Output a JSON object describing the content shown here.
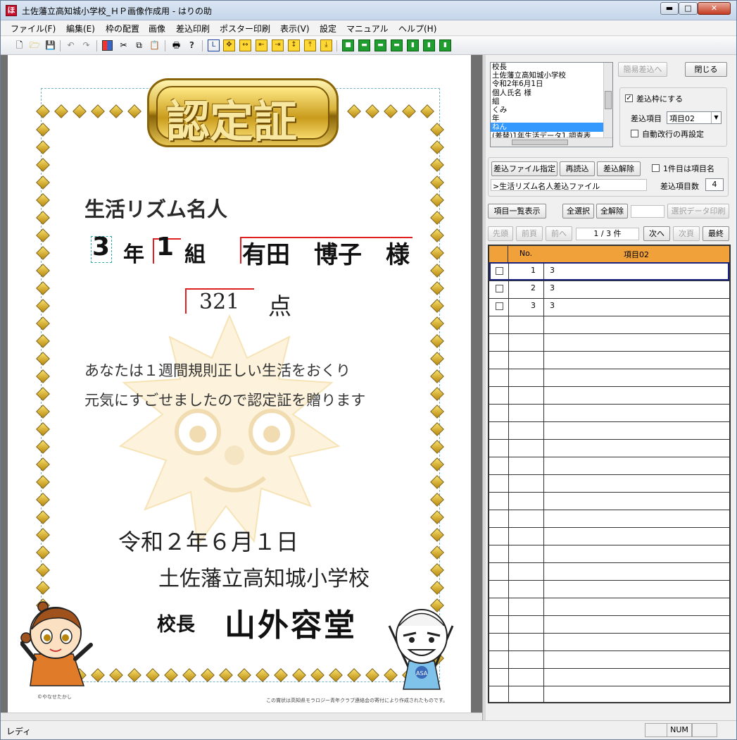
{
  "window": {
    "title": "土佐藩立高知城小学校_ＨＰ画像作成用 - はりの助",
    "icon_label": "ほ",
    "minimize": "▬",
    "maximize": "□",
    "close": "✕"
  },
  "menu": [
    "ファイル(F)",
    "編集(E)",
    "枠の配置",
    "画像",
    "差込印刷",
    "ポスター印刷",
    "表示(V)",
    "設定",
    "マニュアル",
    "ヘルプ(H)"
  ],
  "toolbar_icons": [
    "new-icon",
    "open-icon",
    "save-icon",
    "undo-icon",
    "redo-icon",
    "frame-icon",
    "cut-icon",
    "copy-icon",
    "paste-icon",
    "print-icon",
    "help-icon",
    "align-corner-icon",
    "move-all-icon",
    "stretch-h-icon",
    "align-left-icon",
    "align-right-icon",
    "stretch-v-icon",
    "align-top-icon",
    "align-bottom-icon",
    "layout-1-icon",
    "layout-2-icon",
    "layout-3-icon",
    "layout-4-icon",
    "layout-5-icon",
    "layout-6-icon",
    "layout-7-icon"
  ],
  "certificate": {
    "badge": "認定証",
    "award_title": "生活リズム名人",
    "grade_num": "3",
    "grade_suffix": "年",
    "class_num": "1",
    "class_suffix": "組",
    "student_name": "有田　博子　様",
    "score": "321",
    "score_unit": "点",
    "body_line1": "あなたは１週間規則正しい生活をおくり",
    "body_line2": "元気にすごせましたので認定証を贈ります",
    "date": "令和２年６月１日",
    "school": "土佐藩立高知城小学校",
    "principal_title": "校長",
    "principal_name": "山外容堂",
    "credit_left": "©やなせたかし",
    "credit_right": "この賞状は高知県モラロジー青年クラブ連絡会の寄付により作成されたものです。",
    "mascot_label": "ASA"
  },
  "panel": {
    "fields_list": [
      "校長",
      "土佐藩立高知城小学校",
      "令和2年6月1日",
      "個人氏名 様",
      "組",
      "くみ",
      "年",
      "ねん",
      "(差替)1年生活データ1.調査表"
    ],
    "selected_field_index": 7,
    "simple_insert_btn": "簡易差込へ",
    "close_btn": "閉じる",
    "insert_frame_label": "差込枠にする",
    "insert_frame_checked": true,
    "insert_item_label": "差込項目",
    "insert_item_value": "項目02",
    "auto_wrap_label": "自動改行の再設定",
    "auto_wrap_checked": false,
    "specify_file_btn": "差込ファイル指定",
    "reload_btn": "再読込",
    "release_btn": "差込解除",
    "first_item_label": "1件目は項目名",
    "first_item_checked": false,
    "file_name": ">生活リズム名人差込ファイル",
    "item_count_label": "差込項目数",
    "item_count": "4",
    "list_items_btn": "項目一覧表示",
    "select_all_btn": "全選択",
    "deselect_all_btn": "全解除",
    "print_selected_btn": "選択データ印刷",
    "nav_first": "先頭",
    "nav_prev_page": "前頁",
    "nav_prev": "前へ",
    "record_position": "1 / 3 件",
    "nav_next": "次へ",
    "nav_next_page": "次頁",
    "nav_last": "最終"
  },
  "grid": {
    "headers": [
      "",
      "No.",
      "項目02"
    ],
    "rows": [
      {
        "no": "1",
        "value": "3"
      },
      {
        "no": "2",
        "value": "3"
      },
      {
        "no": "3",
        "value": "3"
      }
    ],
    "header_color": "#f0a13a"
  },
  "status": {
    "text": "レディ",
    "num": "NUM"
  }
}
